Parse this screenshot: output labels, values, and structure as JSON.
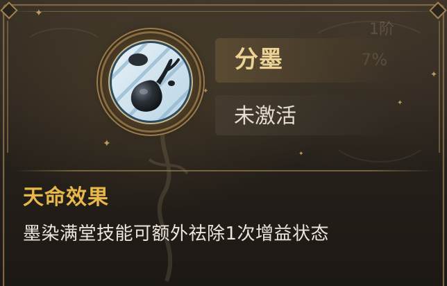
{
  "skill": {
    "name": "分墨",
    "status": "未激活",
    "icon": "ink-drop-icon"
  },
  "effect": {
    "title": "天命效果",
    "description": "墨染满堂技能可额外祛除1次增益状态"
  },
  "background": {
    "tier_label": "1阶",
    "percent_label": "7%"
  },
  "colors": {
    "skill_name": "#ecd295",
    "effect_title": "#e8b94a",
    "frame": "#9b7b47"
  }
}
